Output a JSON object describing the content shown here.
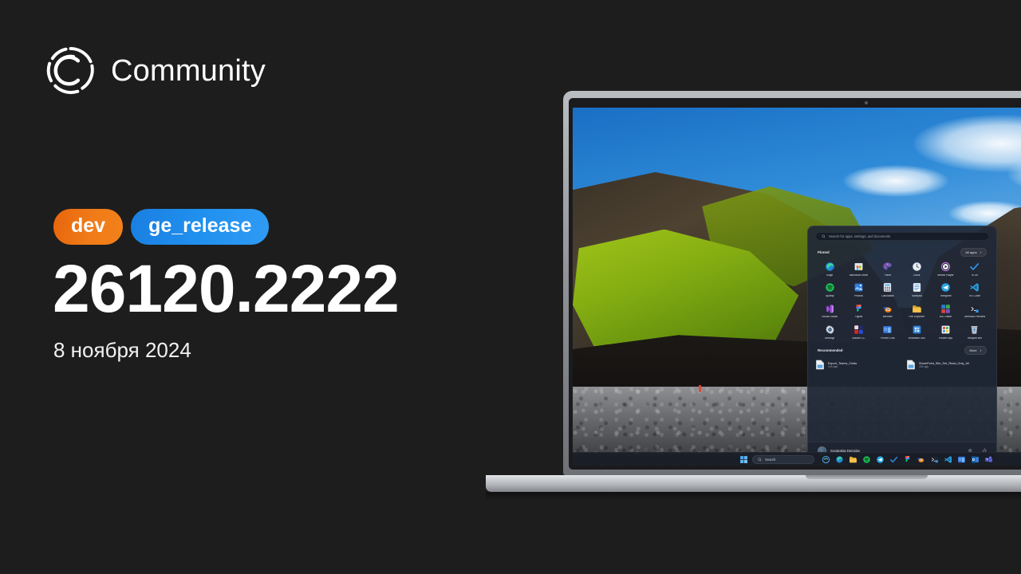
{
  "brand": {
    "logo_icon": "community-c-logo-icon",
    "title": "Community"
  },
  "release": {
    "badges": [
      {
        "label": "dev",
        "color": "#ef7c18"
      },
      {
        "label": "ge_release",
        "color": "#2090ee"
      }
    ],
    "build_number": "26120.2222",
    "date": "8 ноября 2024"
  },
  "laptop": {
    "start_menu": {
      "search": {
        "placeholder": "Search for apps, settings, and documents",
        "icon": "search-icon"
      },
      "pinned": {
        "heading": "Pinned",
        "all_apps_label": "All apps",
        "all_apps_icon": "chevron-right-icon",
        "apps": [
          {
            "label": "Edge",
            "icon": "edge-icon"
          },
          {
            "label": "Microsoft Store",
            "icon": "microsoft-store-icon"
          },
          {
            "label": "Paint",
            "icon": "paint-icon"
          },
          {
            "label": "Clock",
            "icon": "clock-icon"
          },
          {
            "label": "Media Player",
            "icon": "media-player-icon"
          },
          {
            "label": "To Do",
            "icon": "to-do-icon"
          },
          {
            "label": "Spotify",
            "icon": "spotify-icon"
          },
          {
            "label": "Photos",
            "icon": "photos-icon"
          },
          {
            "label": "Calculator",
            "icon": "calculator-icon"
          },
          {
            "label": "Notepad",
            "icon": "notepad-icon"
          },
          {
            "label": "Telegram",
            "icon": "telegram-icon"
          },
          {
            "label": "VS Code",
            "icon": "vs-code-icon"
          },
          {
            "label": "Visual Studio",
            "icon": "visual-studio-icon"
          },
          {
            "label": "Figma",
            "icon": "figma-icon"
          },
          {
            "label": "Blender",
            "icon": "blender-icon"
          },
          {
            "label": "File Explorer",
            "icon": "file-explorer-icon"
          },
          {
            "label": "MS Office",
            "icon": "ms-office-icon"
          },
          {
            "label": "Terminal Preview",
            "icon": "terminal-preview-icon"
          },
          {
            "label": "Settings",
            "icon": "settings-gear-icon"
          },
          {
            "label": "Adobe CC",
            "icon": "adobe-cc-icon"
          },
          {
            "label": "Phone Link",
            "icon": "phone-link-icon"
          },
          {
            "label": "Windows 365",
            "icon": "windows-365-icon"
          },
          {
            "label": "PowerToys",
            "icon": "powertoys-icon"
          },
          {
            "label": "Recycle Bin",
            "icon": "recycle-bin-icon"
          }
        ]
      },
      "recommended": {
        "heading": "Recommended",
        "more_label": "More",
        "more_icon": "chevron-right-icon",
        "items": [
          {
            "name": "Export_Teams_Chats",
            "time": "14h ago",
            "icon": "document-icon"
          },
          {
            "name": "SharePoint_Site_Set_Read_Only_All",
            "time": "15h ago",
            "icon": "document-icon"
          }
        ]
      },
      "account": {
        "user_name": "Svyatoslav Demidov",
        "avatar_icon": "user-avatar",
        "settings_icon": "gear-icon",
        "power_icon": "power-icon"
      }
    },
    "taskbar": {
      "start_icon": "windows-start-icon",
      "search_label": "Search",
      "search_icon": "search-icon",
      "icons": [
        "edge-icon",
        "copilot-icon",
        "file-explorer-icon",
        "spotify-icon",
        "telegram-icon",
        "to-do-icon",
        "figma-icon",
        "blender-icon",
        "terminal-preview-icon",
        "vs-code-icon",
        "phone-link-icon",
        "outlook-icon",
        "teams-icon"
      ]
    },
    "wallpaper": "iceland-cliff-beach-photo"
  }
}
